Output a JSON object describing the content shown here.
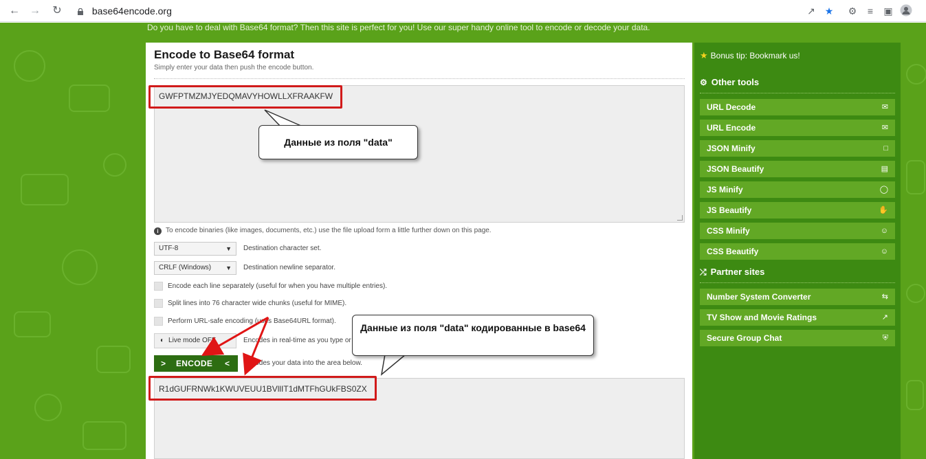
{
  "browser": {
    "url": "base64encode.org"
  },
  "page": {
    "intro": "Do you have to deal with Base64 format? Then this site is perfect for you! Use our super handy online tool to encode or decode your data.",
    "title": "Encode to Base64 format",
    "subtitle": "Simply enter your data then push the encode button.",
    "input_value": "GWFPTMZMJYEDQMAVYHOWLLXFRAAKFW",
    "info_text": "To encode binaries (like images, documents, etc.) use the file upload form a little further down on this page.",
    "charset": {
      "selected": "UTF-8",
      "label": "Destination character set."
    },
    "newline": {
      "selected": "CRLF (Windows)",
      "label": "Destination newline separator."
    },
    "checkboxes": [
      "Encode each line separately (useful for when you have multiple entries).",
      "Split lines into 76 character wide chunks (useful for MIME).",
      "Perform URL-safe encoding (uses Base64URL format)."
    ],
    "live_mode": {
      "label": "Live mode OFF",
      "desc": "Encodes in real-time as you type or paste (supports only the UTF-8 character set)."
    },
    "encode": {
      "label": "ENCODE",
      "left_glyph": ">",
      "right_glyph": "<",
      "desc": "Encodes your data into the area below."
    },
    "output_value": "R1dGUFRNWk1KWUVEUU1BVllIT1dMTFhGUkFBS0ZX"
  },
  "sidebar": {
    "bonus": "Bonus tip: Bookmark us!",
    "other_tools_heading": "Other tools",
    "tools": [
      {
        "label": "URL Decode",
        "icon": "envelope-open-icon"
      },
      {
        "label": "URL Encode",
        "icon": "envelope-icon"
      },
      {
        "label": "JSON Minify",
        "icon": "file-icon"
      },
      {
        "label": "JSON Beautify",
        "icon": "file-text-icon"
      },
      {
        "label": "JS Minify",
        "icon": "thumbs-icon"
      },
      {
        "label": "JS Beautify",
        "icon": "hand-icon"
      },
      {
        "label": "CSS Minify",
        "icon": "meh-icon"
      },
      {
        "label": "CSS Beautify",
        "icon": "smile-icon"
      }
    ],
    "partner_heading": "Partner sites",
    "partners": [
      {
        "label": "Number System Converter",
        "icon": "exchange-icon"
      },
      {
        "label": "TV Show and Movie Ratings",
        "icon": "chart-icon"
      },
      {
        "label": "Secure Group Chat",
        "icon": "shield-icon"
      }
    ]
  },
  "annotations": {
    "callout_top": "Данные из поля \"data\"",
    "callout_bottom": "Данные из поля \"data\" кодированные в base64",
    "colors": {
      "box": "#d11a1a",
      "arrow": "#e01515"
    }
  }
}
